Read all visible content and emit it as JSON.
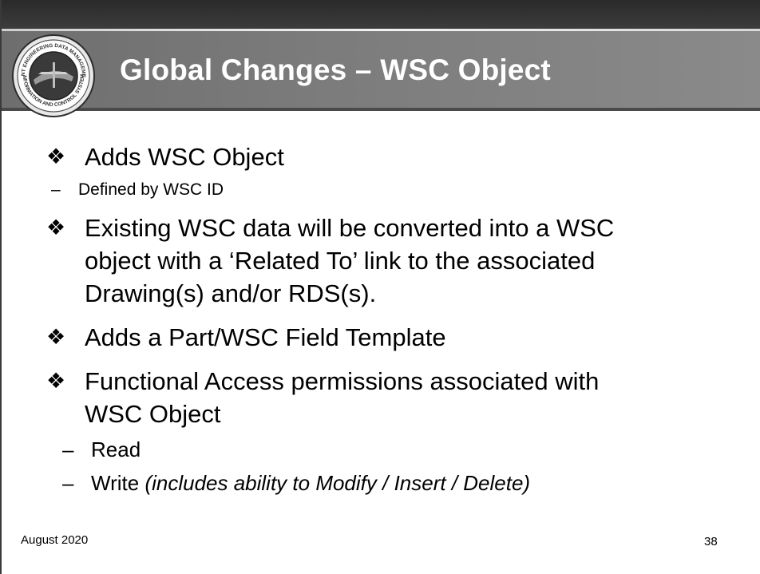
{
  "slide": {
    "title": "Global Changes – WSC Object",
    "seal": {
      "ring_text_top": "JOINT ENGINEERING DATA MANAGEMENT",
      "ring_text_bottom": "INFORMATION AND CONTROL SYSTEM"
    },
    "bullets": [
      {
        "marker": "❖",
        "text": "Adds WSC Object",
        "sub": [
          {
            "marker": "–",
            "text": "Defined by WSC ID"
          }
        ]
      },
      {
        "marker": "❖",
        "text": "Existing WSC data will be converted into a WSC",
        "continuation": [
          "object with a ‘Related To’ link to the associated",
          "Drawing(s) and/or RDS(s)."
        ]
      },
      {
        "marker": "❖",
        "text": "Adds a Part/WSC Field Template"
      },
      {
        "marker": "❖",
        "text": "Functional Access permissions associated with",
        "continuation": [
          "WSC Object"
        ],
        "sub": [
          {
            "marker": "–",
            "text": "Read"
          },
          {
            "marker": "–",
            "text": "Write",
            "italic": "(includes ability to Modify / Insert / Delete)"
          }
        ]
      }
    ],
    "footer_date": "August 2020",
    "page_number": "38"
  }
}
